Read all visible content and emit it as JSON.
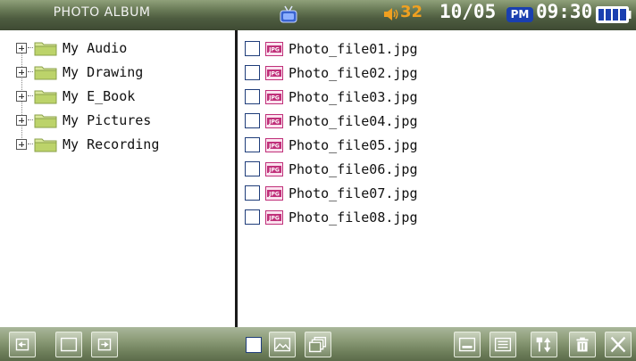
{
  "status_bar": {
    "title": "PHOTO ALBUM",
    "volume": "32",
    "date": "10/05",
    "ampm": "PM",
    "time": "09:30"
  },
  "folders": [
    {
      "label": "My Audio"
    },
    {
      "label": "My Drawing"
    },
    {
      "label": "My E_Book"
    },
    {
      "label": "My Pictures"
    },
    {
      "label": "My Recording"
    }
  ],
  "files": [
    {
      "label": "Photo_file01.jpg"
    },
    {
      "label": "Photo_file02.jpg"
    },
    {
      "label": "Photo_file03.jpg"
    },
    {
      "label": "Photo_file04.jpg"
    },
    {
      "label": "Photo_file05.jpg"
    },
    {
      "label": "Photo_file06.jpg"
    },
    {
      "label": "Photo_file07.jpg"
    },
    {
      "label": "Photo_file08.jpg"
    }
  ],
  "colors": {
    "accent_volume": "#f0a020",
    "pm_badge": "#1a3fb0",
    "file_icon": "#c0307a"
  },
  "icons": {
    "tv": "tv-icon",
    "volume": "speaker-icon",
    "battery": "battery-icon",
    "folder": "folder-icon",
    "file": "jpg-file-icon"
  }
}
